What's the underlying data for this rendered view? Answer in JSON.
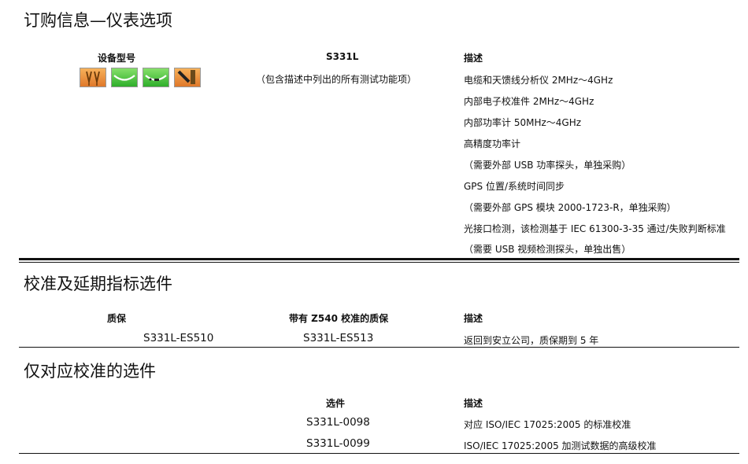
{
  "ordering": {
    "title": "订购信息—仪表选项",
    "col1_header": "设备型号",
    "col2_header": "S331L",
    "col2_sub": "（包含描述中列出的所有测试功能项）",
    "col3_header": "描述",
    "descriptions": [
      "电缆和天馈线分析仪 2MHz～4GHz",
      "内部电子校准件 2MHz～4GHz",
      "内部功率计 50MHz～4GHz",
      "高精度功率计",
      "（需要外部 USB 功率探头，单独采购）",
      "GPS 位置/系统时间同步",
      "（需要外部 GPS 模块 2000-1723-R，单独采购）",
      "光接口检测，该检测基于 IEC 61300-3-35 通过/失败判断标准",
      "（需要 USB 视频检测探头，单独出售）"
    ]
  },
  "calibration": {
    "title": "校准及延期指标选件",
    "col1_header": "质保",
    "col2_header": "带有 Z540 校准的质保",
    "col3_header": "描述",
    "row": {
      "warranty": "S331L-ES510",
      "z540_warranty": "S331L-ES513",
      "description": "返回到安立公司，质保期到 5 年"
    }
  },
  "cal_only": {
    "title": "仅对应校准的选件",
    "col1_header": "选件",
    "col2_header": "描述",
    "rows": [
      {
        "option": "S331L-0098",
        "description": "对应 ISO/IEC 17025:2005 的标准校准"
      },
      {
        "option": "S331L-0099",
        "description": "ISO/IEC 17025:2005 加测试数据的高级校准"
      }
    ]
  },
  "icons": [
    "antenna-icon",
    "cable-icon",
    "usb-cable-icon",
    "probe-icon"
  ]
}
